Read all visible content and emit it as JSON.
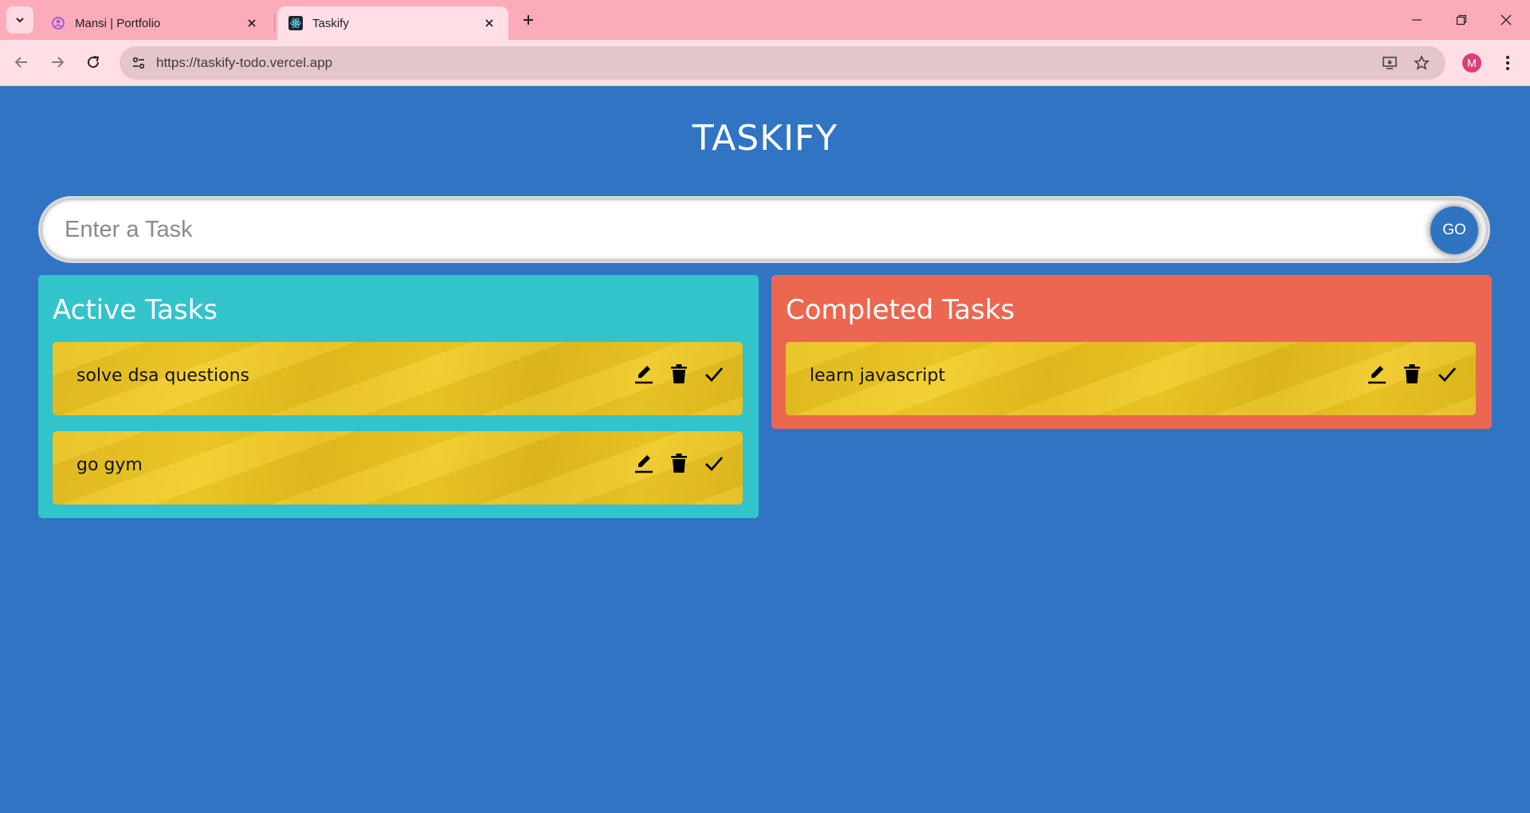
{
  "browser": {
    "tabs": [
      {
        "title": "Mansi | Portfolio",
        "active": false
      },
      {
        "title": "Taskify",
        "active": true
      }
    ],
    "url": "https://taskify-todo.vercel.app",
    "profile_initial": "M"
  },
  "app": {
    "title": "TASKIFY",
    "input": {
      "placeholder": "Enter a Task",
      "value": ""
    },
    "go_label": "GO",
    "active_heading": "Active Tasks",
    "completed_heading": "Completed Tasks",
    "active_tasks": [
      {
        "text": "solve dsa questions"
      },
      {
        "text": "go gym"
      }
    ],
    "completed_tasks": [
      {
        "text": "learn javascript"
      }
    ]
  },
  "colors": {
    "background": "#3174c3",
    "active_panel": "#32c3cb",
    "completed_panel": "#eb6750",
    "card": "#edc822",
    "go_button": "#2f74c0",
    "tab_bar": "#fcabbb"
  },
  "icons": [
    "search-tabs-icon",
    "portfolio-favicon",
    "react-favicon",
    "close-icon",
    "plus-icon",
    "minimize-icon",
    "restore-icon",
    "back-icon",
    "forward-icon",
    "reload-icon",
    "site-settings-icon",
    "install-app-icon",
    "star-icon",
    "more-menu-icon",
    "edit-icon",
    "delete-icon",
    "done-icon"
  ]
}
